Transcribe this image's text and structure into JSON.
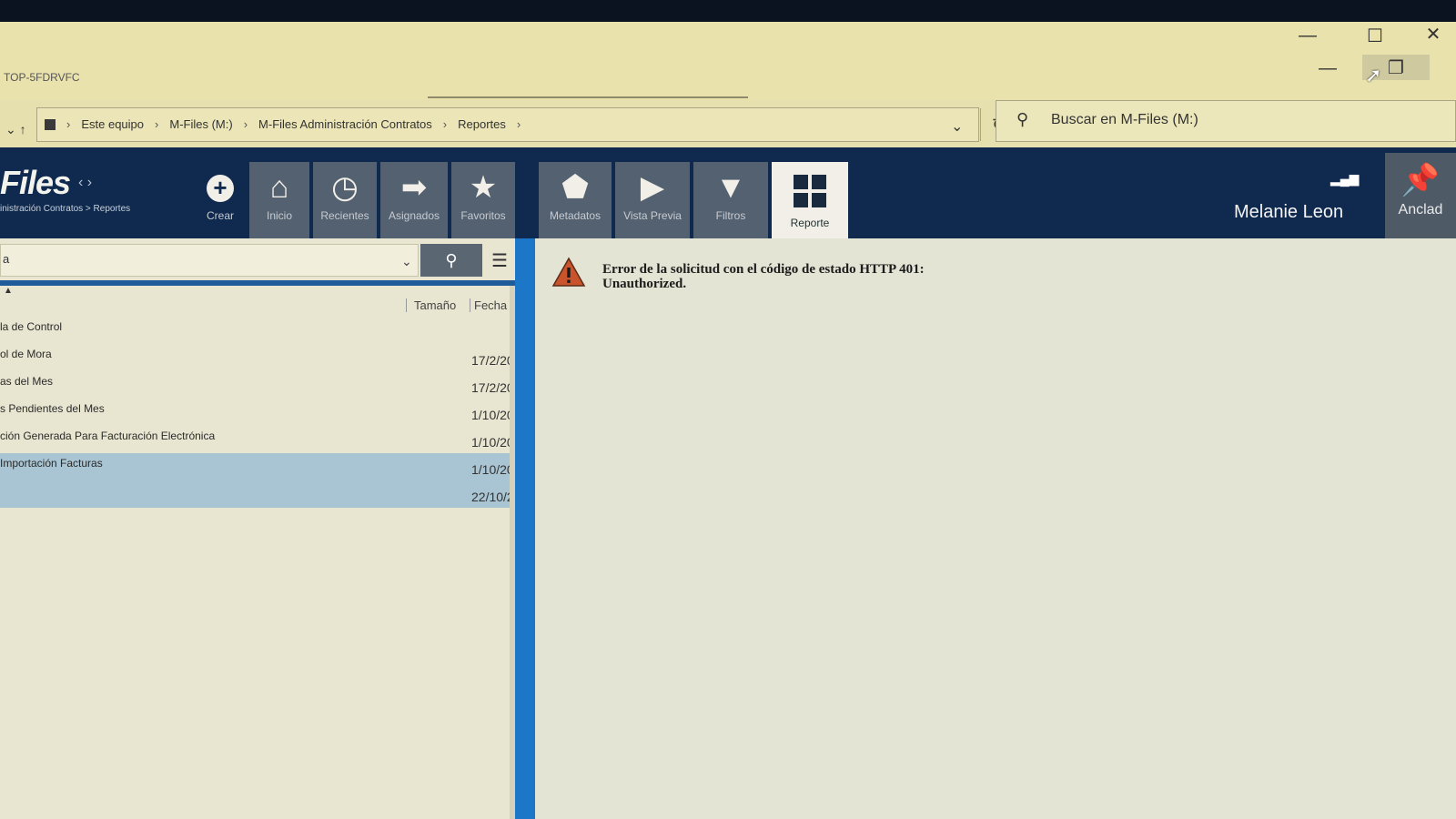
{
  "window": {
    "machine": "TOP-5FDRVFC",
    "minimize": "—",
    "maximize": "☐",
    "close": "✕"
  },
  "address": {
    "crumbs": [
      "Este equipo",
      "M-Files (M:)",
      "M-Files Administración Contratos",
      "Reportes"
    ],
    "search_placeholder": "Buscar en M-Files (M:)"
  },
  "mfiles": {
    "logo": "Files",
    "path": "inistración Contratos > Reportes",
    "toolbar": [
      {
        "label": "Crear",
        "icon": "plus-circle-icon"
      },
      {
        "label": "Inicio",
        "icon": "home-icon"
      },
      {
        "label": "Recientes",
        "icon": "clock-icon"
      },
      {
        "label": "Asignados",
        "icon": "arrow-right-icon"
      },
      {
        "label": "Favoritos",
        "icon": "star-icon"
      },
      {
        "label": "Metadatos",
        "icon": "tag-icon"
      },
      {
        "label": "Vista Previa",
        "icon": "play-icon"
      },
      {
        "label": "Filtros",
        "icon": "filter-icon"
      },
      {
        "label": "Reporte",
        "icon": "grid-icon"
      }
    ],
    "user": "Melanie Leon",
    "pin_label": "Anclad"
  },
  "list": {
    "search_value": "a",
    "columns": {
      "size": "Tamaño",
      "date": "Fecha d"
    },
    "rows": [
      {
        "name": "la de Control",
        "date": ""
      },
      {
        "name": "ol de Mora",
        "date": "17/2/20"
      },
      {
        "name": "as del Mes",
        "date": "17/2/20"
      },
      {
        "name": "s Pendientes del Mes",
        "date": "1/10/20"
      },
      {
        "name": "ción Generada Para Facturación Electrónica",
        "date": "1/10/20"
      },
      {
        "name": "Importación Facturas",
        "date": "1/10/20"
      },
      {
        "name": "",
        "date": "22/10/2"
      }
    ]
  },
  "error": {
    "line1": "Error de la solicitud con el código de estado HTTP 401:",
    "line2": "Unauthorized."
  }
}
